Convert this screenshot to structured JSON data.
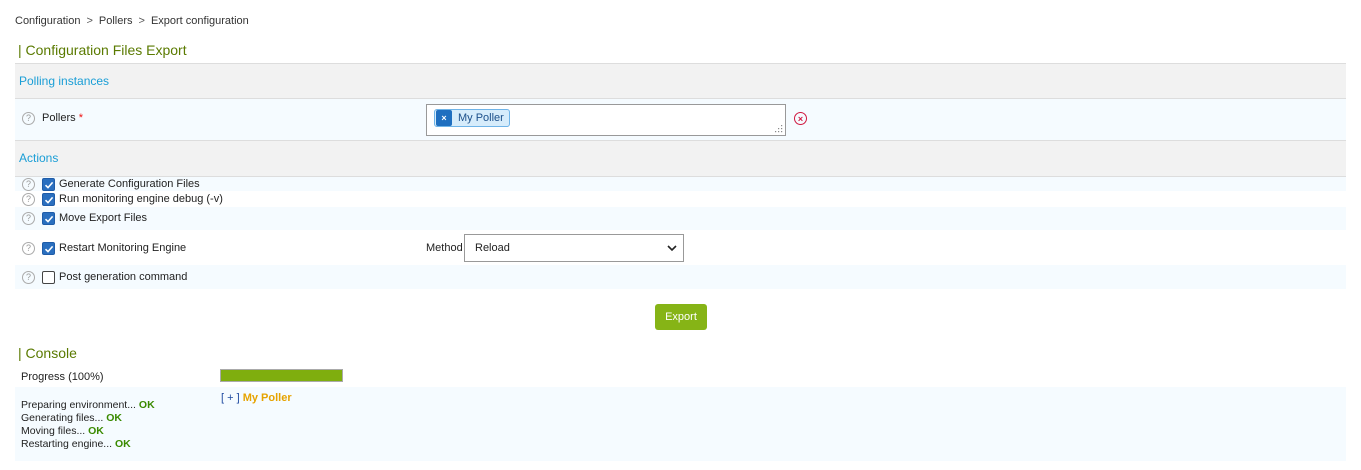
{
  "breadcrumb": {
    "items": [
      "Configuration",
      "Pollers",
      "Export configuration"
    ],
    "separator": ">"
  },
  "page_title": "| Configuration Files Export",
  "polling": {
    "header": "Polling instances",
    "pollers_label": "Pollers",
    "required_mark": "*",
    "selected_tag": "My Poller",
    "tag_remove": "×"
  },
  "actions": {
    "header": "Actions",
    "items": [
      {
        "label": "Generate Configuration Files",
        "checked": true
      },
      {
        "label": "Run monitoring engine debug (-v)",
        "checked": true
      },
      {
        "label": "Move Export Files",
        "checked": true
      },
      {
        "label": "Restart Monitoring Engine",
        "checked": true
      },
      {
        "label": "Post generation command",
        "checked": false
      }
    ],
    "method_label": "Method",
    "method_value": "Reload"
  },
  "export_button": "Export",
  "console": {
    "title": "| Console",
    "progress_label": "Progress",
    "progress_value": "(100%)",
    "progress_fraction": 1.0,
    "expand_toggle": "[ + ]",
    "poller_name": "My Poller",
    "log": [
      {
        "text": "Preparing environment...",
        "status": "OK"
      },
      {
        "text": "Generating files...",
        "status": "OK"
      },
      {
        "text": "Moving files...",
        "status": "OK"
      },
      {
        "text": "Restarting engine...",
        "status": "OK"
      }
    ]
  },
  "colors": {
    "accent": "#1a9ed6",
    "title": "#5a7a00",
    "button": "#86b416",
    "ok": "#3a8a00",
    "poller": "#e6a300"
  }
}
